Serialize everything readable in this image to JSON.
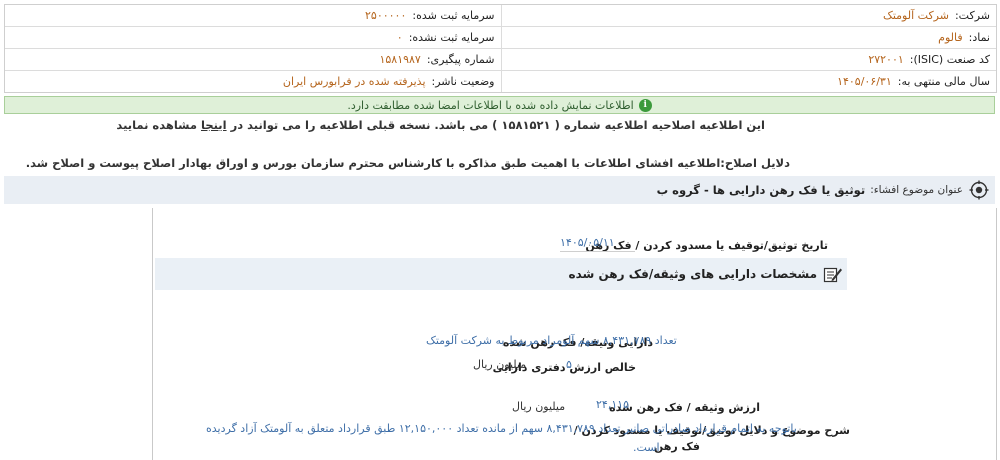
{
  "header": {
    "company_label": "شرکت:",
    "company_value": "شرکت آلومتک",
    "registered_capital_label": "سرمایه ثبت شده:",
    "registered_capital_value": "۲۵۰۰۰۰۰",
    "symbol_label": "نماد:",
    "symbol_value": "فالوم",
    "unregistered_capital_label": "سرمایه ثبت نشده:",
    "unregistered_capital_value": "۰",
    "isic_label": "کد صنعت (ISIC):",
    "isic_value": "۲۷۲۰۰۱",
    "tracking_label": "شماره پیگیری:",
    "tracking_value": "۱۵۸۱۹۸۷",
    "fiscal_year_label": "سال مالی منتهی به:",
    "fiscal_year_value": "۱۴۰۵/۰۶/۳۱",
    "publisher_status_label": "وضعیت ناشر:",
    "publisher_status_value": "پذیرفته شده در فرابورس ایران"
  },
  "success_message": "اطلاعات نمایش داده شده با اطلاعات امضا شده مطابقت دارد.",
  "notice": {
    "before": "این اطلاعیه اصلاحیه اطلاعیه شماره ( ۱۵۸۱۵۲۱ ) می باشد. نسخه قبلی اطلاعیه را می توانید در",
    "link": "اینجا",
    "after": "مشاهده نمایید"
  },
  "correction_reason": "دلایل اصلاح:اطلاعیه افشای اطلاعات با اهمیت طبق مذاکره با کارشناس محترم سازمان بورس و اوراق بهادار اصلاح پیوست و اصلاح شد.",
  "title": {
    "label": "عنوان موضوع افشاء:",
    "value": "توثیق یا فک رهن دارایی ها - گروه ب"
  },
  "date": {
    "label": "تاریخ توثیق/توقیف یا مسدود کردن / فک رهن",
    "value": "۱۴۰۵/۰۵/۱۱"
  },
  "section_title": "مشخصات دارایی های وثیقه/فک رهن شده",
  "asset": {
    "label": "دارایی وثیقه/ فک رهن شده",
    "value": "تعداد ۸,۴۳۱,۷۸۹ سهم آلومراد مربوط به شرکت آلومتک"
  },
  "book_value": {
    "label": "خالص ارزش دفتری دارایی",
    "value": "۵",
    "unit": "میلیون ریال"
  },
  "collateral_value": {
    "label": "ارزش وثیقه / فک رهن شده",
    "value": "۲۴,۱۱۵",
    "unit": "میلیون ریال"
  },
  "description": {
    "label_line1": "شرح موضوع و دلایل توثیق/توقیف یا مسدود کردن /",
    "label_line2": "فک رهن",
    "value_line1": "باتوجه به اتمام قرارداد صادراتی صانیر تعداد ۸,۴۳۱,۷۸۹ سهم از مانده تعداد ۱۲,۱۵۰,۰۰۰ طبق قرارداد متعلق به آلومتک آزاد گردیده",
    "value_line2": "است."
  },
  "colors": {
    "value_orange": "#b5651d",
    "value_blue": "#3f6fa8",
    "success_bg": "#dff0d8",
    "title_bar_bg": "#e9eef4"
  },
  "icons": {
    "success": "info-circle-icon",
    "title": "target-icon",
    "section": "edit-icon"
  }
}
